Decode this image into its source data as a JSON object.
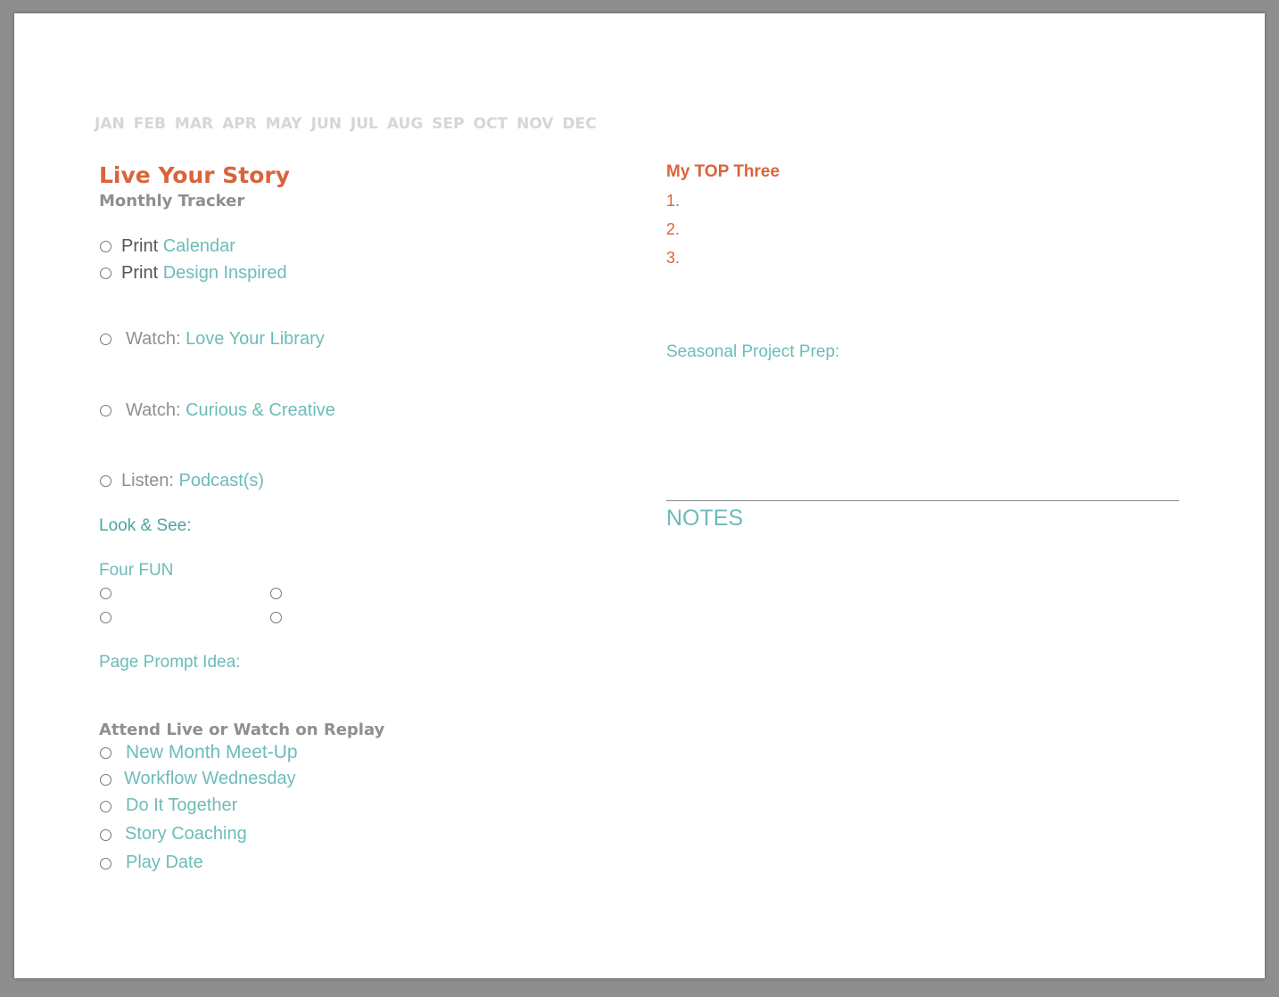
{
  "months": [
    "JAN",
    "FEB",
    "MAR",
    "APR",
    "MAY",
    "JUN",
    "JUL",
    "AUG",
    "SEP",
    "OCT",
    "NOV",
    "DEC"
  ],
  "title": "Live Your Story",
  "subtitle": "Monthly Tracker",
  "checklist": [
    {
      "prefix": "Print",
      "label": "Calendar"
    },
    {
      "prefix": "Print",
      "label": "Design Inspired"
    },
    {
      "prefix": "Watch:",
      "label": "Love Your Library"
    },
    {
      "prefix": "Watch:",
      "label": "Curious & Creative"
    },
    {
      "prefix": "Listen:",
      "label": "Podcast(s)"
    }
  ],
  "look_and_see": "Look & See:",
  "four_fun": "Four FUN",
  "page_prompt": "Page Prompt Idea:",
  "attend_heading": "Attend Live or Watch on Replay",
  "events": [
    "New Month Meet-Up",
    "Workflow Wednesday",
    "Do It Together",
    "Story Coaching",
    "Play Date"
  ],
  "top_three": {
    "heading": "My TOP Three",
    "items": [
      "1.",
      "2.",
      "3."
    ]
  },
  "seasonal": "Seasonal Project Prep:",
  "notes": "NOTES",
  "colors": {
    "accent_teal": "#6cbcb8",
    "accent_orange": "#d9643a",
    "month_gray": "#d6d6d6",
    "heading_gray": "#8f8f8f"
  }
}
